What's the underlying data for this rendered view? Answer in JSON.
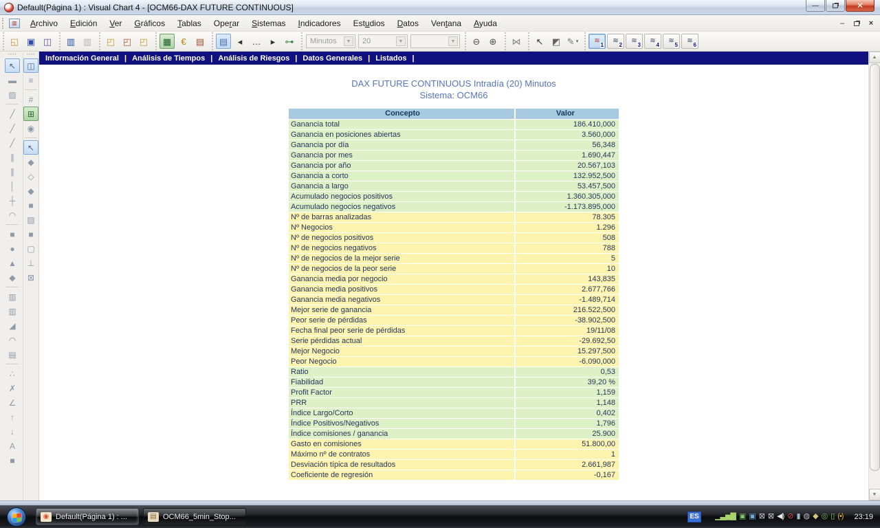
{
  "window": {
    "title": "Default(Página 1) : Visual Chart 4 - [OCM66-DAX FUTURE CONTINUOUS]"
  },
  "menubar": {
    "items": [
      {
        "label": "Archivo",
        "u": 0
      },
      {
        "label": "Edición",
        "u": 0
      },
      {
        "label": "Ver",
        "u": 0
      },
      {
        "label": "Gráficos",
        "u": 0
      },
      {
        "label": "Tablas",
        "u": 0
      },
      {
        "label": "Operar",
        "u": 3
      },
      {
        "label": "Sistemas",
        "u": 0
      },
      {
        "label": "Indicadores",
        "u": 0
      },
      {
        "label": "Estudios",
        "u": 3
      },
      {
        "label": "Datos",
        "u": 0
      },
      {
        "label": "Ventana",
        "u": 3
      },
      {
        "label": "Ayuda",
        "u": 0
      }
    ]
  },
  "toolbar": {
    "sections": [
      {
        "kind": "icons",
        "icons": [
          {
            "name": "open-file-icon",
            "glyph": "◱",
            "color": "#C79A36"
          },
          {
            "name": "save-icon",
            "glyph": "▣",
            "color": "#2E4FA3"
          },
          {
            "name": "save-workspace-icon",
            "glyph": "◫",
            "color": "#6A4FA3"
          }
        ]
      },
      {
        "kind": "icons",
        "icons": [
          {
            "name": "bar-chart-icon",
            "glyph": "▥",
            "color": "#2E4FA3"
          },
          {
            "name": "bar-chart-disabled-icon",
            "glyph": "▥",
            "color": "#AAA",
            "dis": true
          }
        ]
      },
      {
        "kind": "icons",
        "icons": [
          {
            "name": "new-chart-folder-icon",
            "glyph": "◰",
            "color": "#C79A36"
          },
          {
            "name": "chart-flag-folder-icon",
            "glyph": "◰",
            "color": "#B5543A"
          },
          {
            "name": "chart-window-folder-icon",
            "glyph": "◰",
            "color": "#C79A36"
          }
        ]
      },
      {
        "kind": "icons",
        "icons": [
          {
            "name": "trading-table-icon",
            "glyph": "▦",
            "color": "#1E5B2E",
            "selg": true
          },
          {
            "name": "key-euro-icon",
            "glyph": "€",
            "color": "#B8860B"
          },
          {
            "name": "calendar-edit-icon",
            "glyph": "▤",
            "color": "#A0522D"
          }
        ]
      },
      {
        "kind": "icons",
        "icons": [
          {
            "name": "properties-icon",
            "glyph": "▤",
            "color": "#4A6EA9",
            "sel": true
          },
          {
            "name": "prev-page-icon",
            "glyph": "◂",
            "color": "#333333"
          },
          {
            "name": "more-pages-icon",
            "glyph": "…",
            "color": "#333333"
          },
          {
            "name": "next-page-icon",
            "glyph": "▸",
            "color": "#333333"
          },
          {
            "name": "object-links-icon",
            "glyph": "⊶",
            "color": "#2E7D32"
          }
        ]
      },
      {
        "kind": "combos"
      },
      {
        "kind": "icons",
        "icons": [
          {
            "name": "zoom-out-icon",
            "glyph": "⊖",
            "color": "#555555"
          },
          {
            "name": "zoom-in-icon",
            "glyph": "⊕",
            "color": "#555555"
          }
        ]
      },
      {
        "kind": "icons",
        "icons": [
          {
            "name": "hide-crosses-icon",
            "glyph": "⋈",
            "color": "#88857F"
          }
        ]
      },
      {
        "kind": "icons",
        "icons": [
          {
            "name": "pointer-icon",
            "glyph": "↖",
            "color": "#333333"
          },
          {
            "name": "pointer-object-icon",
            "glyph": "◩",
            "color": "#666666"
          },
          {
            "name": "highlight-pen-icon",
            "glyph": "✎",
            "color": "#77746E",
            "caret": true
          }
        ]
      },
      {
        "kind": "pages"
      }
    ],
    "combos": [
      {
        "name": "compression-combo",
        "value": "Minutos",
        "disabled": true
      },
      {
        "name": "periods-combo",
        "value": "20",
        "disabled": true
      },
      {
        "name": "extra-combo",
        "value": "",
        "disabled": true
      }
    ],
    "pages": [
      {
        "label": "1",
        "selected": true
      },
      {
        "label": "2",
        "selected": false
      },
      {
        "label": "3",
        "selected": false
      },
      {
        "label": "4",
        "selected": false
      },
      {
        "label": "5",
        "selected": false
      },
      {
        "label": "6",
        "selected": false
      }
    ]
  },
  "nav": {
    "tabs": [
      "Información General",
      "Análisis de Tiempos",
      "Análisis de Riesgos",
      "Datos Generales",
      "Listados"
    ]
  },
  "report": {
    "title_line1": "DAX FUTURE CONTINUOUS Intradía (20) Minutos",
    "title_line2": "Sistema: OCM66",
    "columns": [
      "Concepto",
      "Valor"
    ],
    "rows": [
      {
        "concept": "Ganancia total",
        "value": "186.410,000",
        "tone": "g"
      },
      {
        "concept": "Ganancia en posiciones abiertas",
        "value": "3.560,000",
        "tone": "g"
      },
      {
        "concept": "Ganancia por día",
        "value": "56,348",
        "tone": "g"
      },
      {
        "concept": "Ganancia por mes",
        "value": "1.690,447",
        "tone": "g"
      },
      {
        "concept": "Ganancia por año",
        "value": "20.567,103",
        "tone": "g"
      },
      {
        "concept": "Ganancia a corto",
        "value": "132.952,500",
        "tone": "g"
      },
      {
        "concept": "Ganancia a largo",
        "value": "53.457,500",
        "tone": "g"
      },
      {
        "concept": "Acumulado negocios positivos",
        "value": "1.360.305,000",
        "tone": "g"
      },
      {
        "concept": "Acumulado negocios negativos",
        "value": "-1.173.895,000",
        "tone": "g"
      },
      {
        "concept": "Nº de barras analizadas",
        "value": "78.305",
        "tone": "y"
      },
      {
        "concept": "Nº Negocios",
        "value": "1.296",
        "tone": "y"
      },
      {
        "concept": "Nº de negocios positivos",
        "value": "508",
        "tone": "y"
      },
      {
        "concept": "Nº de negocios negativos",
        "value": "788",
        "tone": "y"
      },
      {
        "concept": "Nº de negocios de la mejor serie",
        "value": "5",
        "tone": "y"
      },
      {
        "concept": "Nº de negocios de la peor serie",
        "value": "10",
        "tone": "y"
      },
      {
        "concept": "Ganancia media por negocio",
        "value": "143,835",
        "tone": "y"
      },
      {
        "concept": "Ganancia media positivos",
        "value": "2.677,766",
        "tone": "y"
      },
      {
        "concept": "Ganancia media negativos",
        "value": "-1.489,714",
        "tone": "y"
      },
      {
        "concept": "Mejor serie de ganancia",
        "value": "216.522,500",
        "tone": "y"
      },
      {
        "concept": "Peor serie de pérdidas",
        "value": "-38.902,500",
        "tone": "y"
      },
      {
        "concept": "Fecha final peor serie de pérdidas",
        "value": "19/11/08",
        "tone": "y"
      },
      {
        "concept": "Serie pérdidas actual",
        "value": "-29.692,50",
        "tone": "y"
      },
      {
        "concept": "Mejor Negocio",
        "value": "15.297,500",
        "tone": "y"
      },
      {
        "concept": "Peor Negocio",
        "value": "-6.090,000",
        "tone": "y"
      },
      {
        "concept": "Ratio",
        "value": "0,53",
        "tone": "g"
      },
      {
        "concept": "Fiabilidad",
        "value": "39,20 %",
        "tone": "g"
      },
      {
        "concept": "Profit Factor",
        "value": "1,159",
        "tone": "g"
      },
      {
        "concept": "PRR",
        "value": "1,148",
        "tone": "g"
      },
      {
        "concept": "Índice Largo/Corto",
        "value": "0,402",
        "tone": "g"
      },
      {
        "concept": "Índice Positivos/Negativos",
        "value": "1,796",
        "tone": "g"
      },
      {
        "concept": "Índice comisiones / ganancia",
        "value": "25.900",
        "tone": "g"
      },
      {
        "concept": "Gasto en comisiones",
        "value": "51.800,00",
        "tone": "y"
      },
      {
        "concept": "Máximo nº de contratos",
        "value": "1",
        "tone": "y"
      },
      {
        "concept": "Desviación típica de resultados",
        "value": "2.661,987",
        "tone": "y"
      },
      {
        "concept": "Coeficiente de regresión",
        "value": "-0,167",
        "tone": "y"
      }
    ]
  },
  "sidebar": {
    "col1": [
      {
        "name": "pointer-tool",
        "glyph": "↖",
        "sel": true
      },
      {
        "name": "pin-bar-tool",
        "glyph": "▬"
      },
      {
        "name": "pattern-rect-tool",
        "glyph": "▨"
      },
      {
        "divider": true
      },
      {
        "name": "trend-line-tool",
        "glyph": "╱"
      },
      {
        "name": "trend-segment-tool",
        "glyph": "╱"
      },
      {
        "name": "ray-line-tool",
        "glyph": "╱"
      },
      {
        "name": "channel-tool",
        "glyph": "∥"
      },
      {
        "name": "parallel-lines-tool",
        "glyph": "∥"
      },
      {
        "name": "vertical-line-tool",
        "glyph": "│"
      },
      {
        "name": "cross-line-tool",
        "glyph": "┼"
      },
      {
        "name": "curve-tool",
        "glyph": "◠"
      },
      {
        "divider": true
      },
      {
        "name": "rectangle-tool",
        "glyph": "■"
      },
      {
        "name": "ellipse-tool",
        "glyph": "●"
      },
      {
        "name": "triangle-tool",
        "glyph": "▲"
      },
      {
        "name": "rhombus-tool",
        "glyph": "◆"
      },
      {
        "divider": true
      },
      {
        "name": "fibo-retracement-tool",
        "glyph": "▥"
      },
      {
        "name": "fibo-time-zones-tool",
        "glyph": "▥"
      },
      {
        "name": "fibo-fan-tool",
        "glyph": "◢"
      },
      {
        "name": "fibo-arcs-tool",
        "glyph": "◠"
      },
      {
        "name": "notes-tool",
        "glyph": "▤"
      },
      {
        "divider": true
      },
      {
        "name": "scatter-marks-tool",
        "glyph": "∴"
      },
      {
        "name": "crossed-trend-tool",
        "glyph": "✗"
      },
      {
        "name": "angle-tool",
        "glyph": "∠"
      },
      {
        "name": "arrow-up-tool",
        "glyph": "↑"
      },
      {
        "name": "arrow-down-tool",
        "glyph": "↓"
      },
      {
        "name": "text-tool",
        "glyph": "A"
      },
      {
        "name": "fill-color-tool",
        "glyph": "■"
      }
    ],
    "col2": [
      {
        "name": "layout-frame-tool",
        "glyph": "◫",
        "sel": true
      },
      {
        "name": "layers-tool",
        "glyph": "≡"
      },
      {
        "divider": true
      },
      {
        "name": "grid-tool",
        "glyph": "#"
      },
      {
        "name": "objects-manager-tool",
        "glyph": "⊞",
        "selg": true
      },
      {
        "name": "send-chart-tool",
        "glyph": "◉"
      },
      {
        "divider": true
      },
      {
        "name": "modify-tool",
        "glyph": "↖",
        "sel": true
      },
      {
        "name": "diamond-tool",
        "glyph": "◆"
      },
      {
        "name": "diamond-dotted-tool",
        "glyph": "◇"
      },
      {
        "name": "diamond-flat-tool",
        "glyph": "◆"
      },
      {
        "name": "gray-rect-tool",
        "glyph": "■"
      },
      {
        "name": "pattern-rect2-tool",
        "glyph": "▨"
      },
      {
        "name": "dark-rect-tool",
        "glyph": "■"
      },
      {
        "name": "command-box-tool",
        "glyph": "▢"
      },
      {
        "name": "stamp-tool",
        "glyph": "⊥"
      },
      {
        "name": "delete-box-tool",
        "glyph": "⊠"
      }
    ]
  },
  "scrollbar": {
    "up": "▲",
    "down": "▼"
  },
  "taskbar": {
    "buttons": [
      {
        "label": "Default(Página 1) : ...",
        "active": true,
        "icon_name": "visual-chart-icon",
        "icon_glyph": "◉",
        "icon_color": "#D94A33",
        "icon_bg": "#F3E6C8"
      },
      {
        "label": "OCM66_5min_Stop...",
        "active": false,
        "icon_name": "document-icon",
        "icon_glyph": "▤",
        "icon_color": "#8A6A3A",
        "icon_bg": "#E8DCC0"
      }
    ],
    "tray": {
      "lang": "ES",
      "icons": [
        {
          "name": "signal-strength-icon",
          "glyph": "▁▃▅▇",
          "color": "#A8D36C"
        },
        {
          "name": "wireless-display-icon",
          "glyph": "▣",
          "color": "#7EC46A"
        },
        {
          "name": "display-icon",
          "glyph": "▣",
          "color": "#6FA8DC"
        },
        {
          "name": "network-disconnected-icon",
          "glyph": "⊠",
          "color": "#C9CDD4"
        },
        {
          "name": "network-disconnected2-icon",
          "glyph": "⊠",
          "color": "#C9CDD4"
        },
        {
          "name": "volume-icon",
          "glyph": "◀)",
          "color": "#E8E8E8"
        },
        {
          "name": "sync-alert-icon",
          "glyph": "⊘",
          "color": "#D9534F"
        },
        {
          "name": "usb-device-icon",
          "glyph": "▮",
          "color": "#9FB6C8"
        },
        {
          "name": "steam-icon",
          "glyph": "◍",
          "color": "#BFC6CE"
        },
        {
          "name": "security-icon",
          "glyph": "◆",
          "color": "#D9C27A"
        },
        {
          "name": "antivirus-icon",
          "glyph": "◎",
          "color": "#7EC46A"
        },
        {
          "name": "performance-icon",
          "glyph": "▯",
          "color": "#9FD36C"
        },
        {
          "name": "wireless-signal-icon",
          "glyph": "(•)",
          "color": "#E8B43C"
        }
      ],
      "clock": "23:19"
    }
  },
  "colors": {
    "navbar": "#10107E",
    "table_header": "#A7CAE1",
    "row_green": "#DDF0C6",
    "row_yellow": "#FCF3AE",
    "report_title": "#5574BC"
  }
}
